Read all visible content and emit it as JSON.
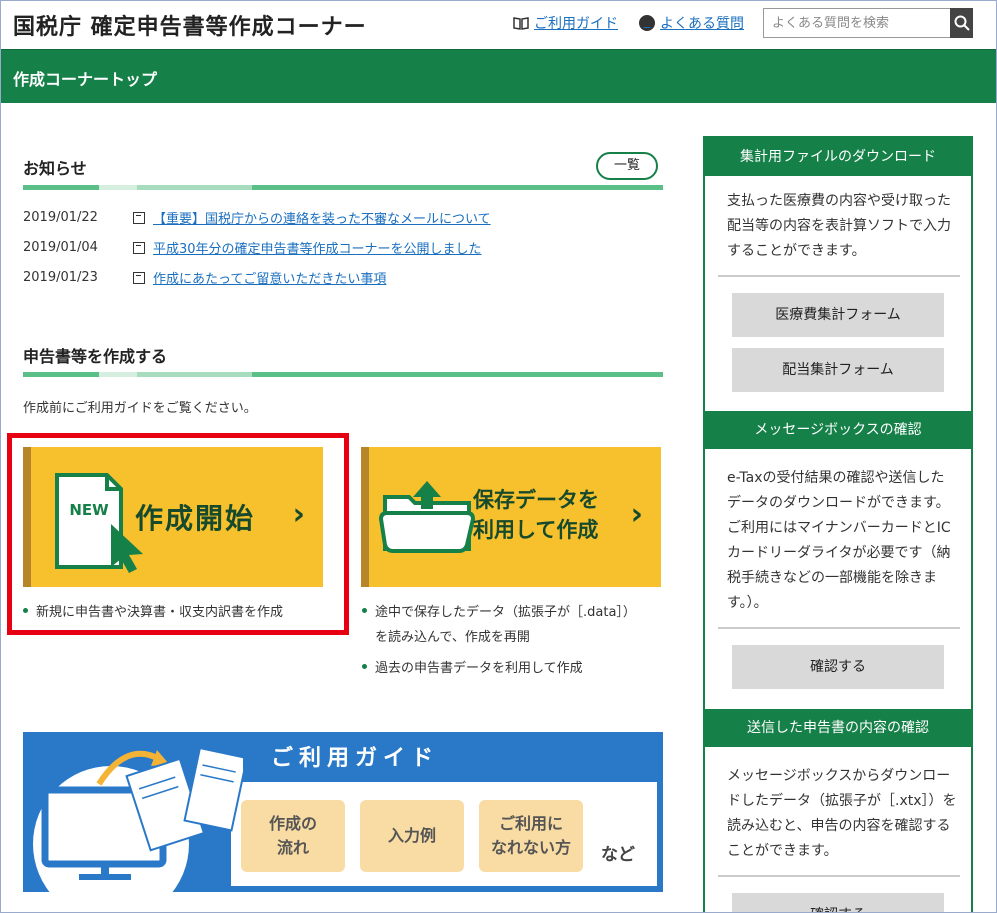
{
  "header": {
    "site_title": "国税庁 確定申告書等作成コーナー",
    "guide_link": "ご利用ガイド",
    "faq_link": "よくある質問",
    "search_placeholder": "よくある質問を検索"
  },
  "page_bar": {
    "title": "作成コーナートップ"
  },
  "news": {
    "heading": "お知らせ",
    "list_button": "一覧",
    "items": [
      {
        "date": "2019/01/22",
        "text": "【重要】国税庁からの連絡を装った不審なメールについて"
      },
      {
        "date": "2019/01/04",
        "text": "平成30年分の確定申告書等作成コーナーを公開しました"
      },
      {
        "date": "2019/01/23",
        "text": "作成にあたってご留意いただきたい事項"
      }
    ]
  },
  "create": {
    "heading": "申告書等を作成する",
    "note": "作成前にご利用ガイドをご覧ください。",
    "start_card": {
      "badge": "NEW",
      "label": "作成開始",
      "bullets": [
        "新規に申告書や決算書・収支内訳書を作成"
      ]
    },
    "saved_card": {
      "label_line1": "保存データを",
      "label_line2": "利用して作成",
      "bullets": [
        "途中で保存したデータ（拡張子が［.data］）",
        "を読み込んで、作成を再開",
        "過去の申告書データを利用して作成"
      ]
    }
  },
  "guide_banner": {
    "title": "ご利用ガイド",
    "buttons": [
      {
        "line1": "作成の",
        "line2": "流れ"
      },
      {
        "line1": "入力例",
        "line2": ""
      },
      {
        "line1": "ご利用に",
        "line2": "なれない方"
      }
    ],
    "suffix": "など"
  },
  "sidebar": {
    "sections": [
      {
        "title": "集計用ファイルのダウンロード",
        "text": "支払った医療費の内容や受け取った配当等の内容を表計算ソフトで入力することができます。",
        "buttons": [
          "医療費集計フォーム",
          "配当集計フォーム"
        ]
      },
      {
        "title": "メッセージボックスの確認",
        "text": "e-Taxの受付結果の確認や送信したデータのダウンロードができます。ご利用にはマイナンバーカードとICカードリーダライタが必要です（納税手続きなどの一部機能を除きます。）。",
        "buttons": [
          "確認する"
        ]
      },
      {
        "title": "送信した申告書の内容の確認",
        "text": "メッセージボックスからダウンロードしたデータ（拡張子が［.xtx］）を読み込むと、申告の内容を確認することができます。",
        "buttons": [
          "確認する"
        ]
      }
    ]
  },
  "colors": {
    "green": "#168049",
    "yellow": "#f7c02d",
    "blue": "#2a79c9",
    "red": "#e60012"
  }
}
